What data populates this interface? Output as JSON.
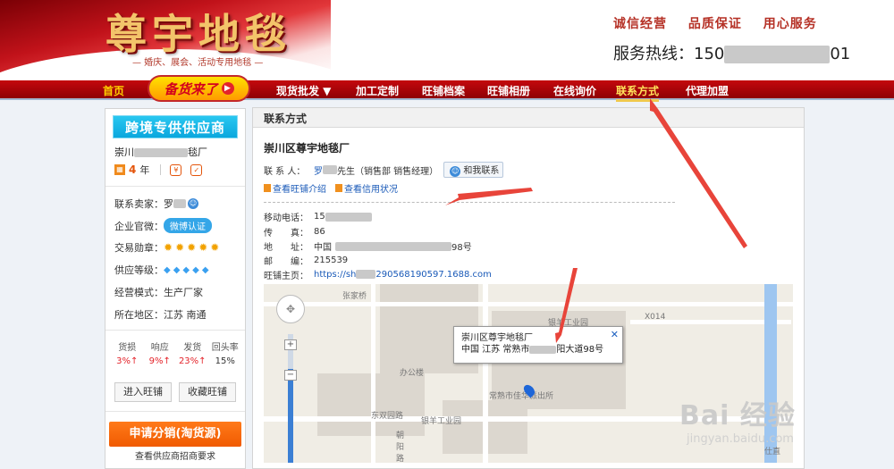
{
  "header": {
    "brand": "尊宇地毯",
    "brand_sub": "— 婚庆、展会、活动专用地毯 —",
    "slogans": [
      "诚信经营",
      "品质保证",
      "用心服务"
    ],
    "hotline_label": "服务热线：",
    "hotline_prefix": "150",
    "hotline_suffix": "01"
  },
  "nav": {
    "home": "首页",
    "promo": "备货来了",
    "items": [
      "现货批发 ▼",
      "加工定制",
      "旺铺档案",
      "旺铺相册",
      "在线询价",
      "联系方式",
      "代理加盟"
    ],
    "active": "联系方式"
  },
  "sidebar": {
    "badge": "跨境专供供应商",
    "company_prefix": "崇川",
    "company_suffix": "毯厂",
    "years_num": "4",
    "years_unit": "年",
    "seller_label": "联系卖家：",
    "seller_name": "罗",
    "website_label": "企业官微：",
    "weibo": "微博认证",
    "medal_label": "交易勋章：",
    "level_label": "供应等级：",
    "mode_label": "经营模式：",
    "mode_value": "生产厂家",
    "region_label": "所在地区：",
    "region_value": "江苏 南通",
    "stats": [
      {
        "label": "货损",
        "value": "3%↑"
      },
      {
        "label": "响应",
        "value": "9%↑"
      },
      {
        "label": "发货",
        "value": "23%↑"
      },
      {
        "label": "回头率",
        "value": "15%"
      }
    ],
    "enter_shop": "进入旺铺",
    "fav_shop": "收藏旺铺",
    "apply": "申请分销(淘货源)",
    "req_link": "查看供应商招商要求"
  },
  "main": {
    "panel_title": "联系方式",
    "company": "崇川区尊宇地毯厂",
    "contact_label": "联 系 人：",
    "contact_name": "罗",
    "contact_role": "先生（销售部 销售经理）",
    "contact_btn": "和我联系",
    "link1": "查看旺铺介绍",
    "link2": "查看信用状况",
    "mobile_label": "移动电话：",
    "mobile_prefix": "15",
    "fax_label": "传　　真：",
    "fax": "86",
    "addr_label": "地　　址：",
    "addr_prefix": "中国",
    "addr_suffix": "98号",
    "zip_label": "邮　　编：",
    "zip": "215539",
    "home_label": "旺铺主页：",
    "home_prefix": "https://sh",
    "home_suffix": "290568190597.1688.com"
  },
  "map": {
    "labels": [
      "张家桥",
      "X014",
      "银羊工业园",
      "办公楼",
      "银羊工业园",
      "东双园路",
      "朝阳路",
      "常熟市佳华派出所",
      "仕直"
    ],
    "popup_line1": "崇川区尊宇地毯厂",
    "popup_line2_prefix": "中国 江苏 常熟市",
    "popup_line2_suffix": "阳大道98号",
    "popup_close": "✕"
  },
  "watermark": {
    "main": "Bai 经验",
    "sub": "jingyan.baidu.com"
  }
}
